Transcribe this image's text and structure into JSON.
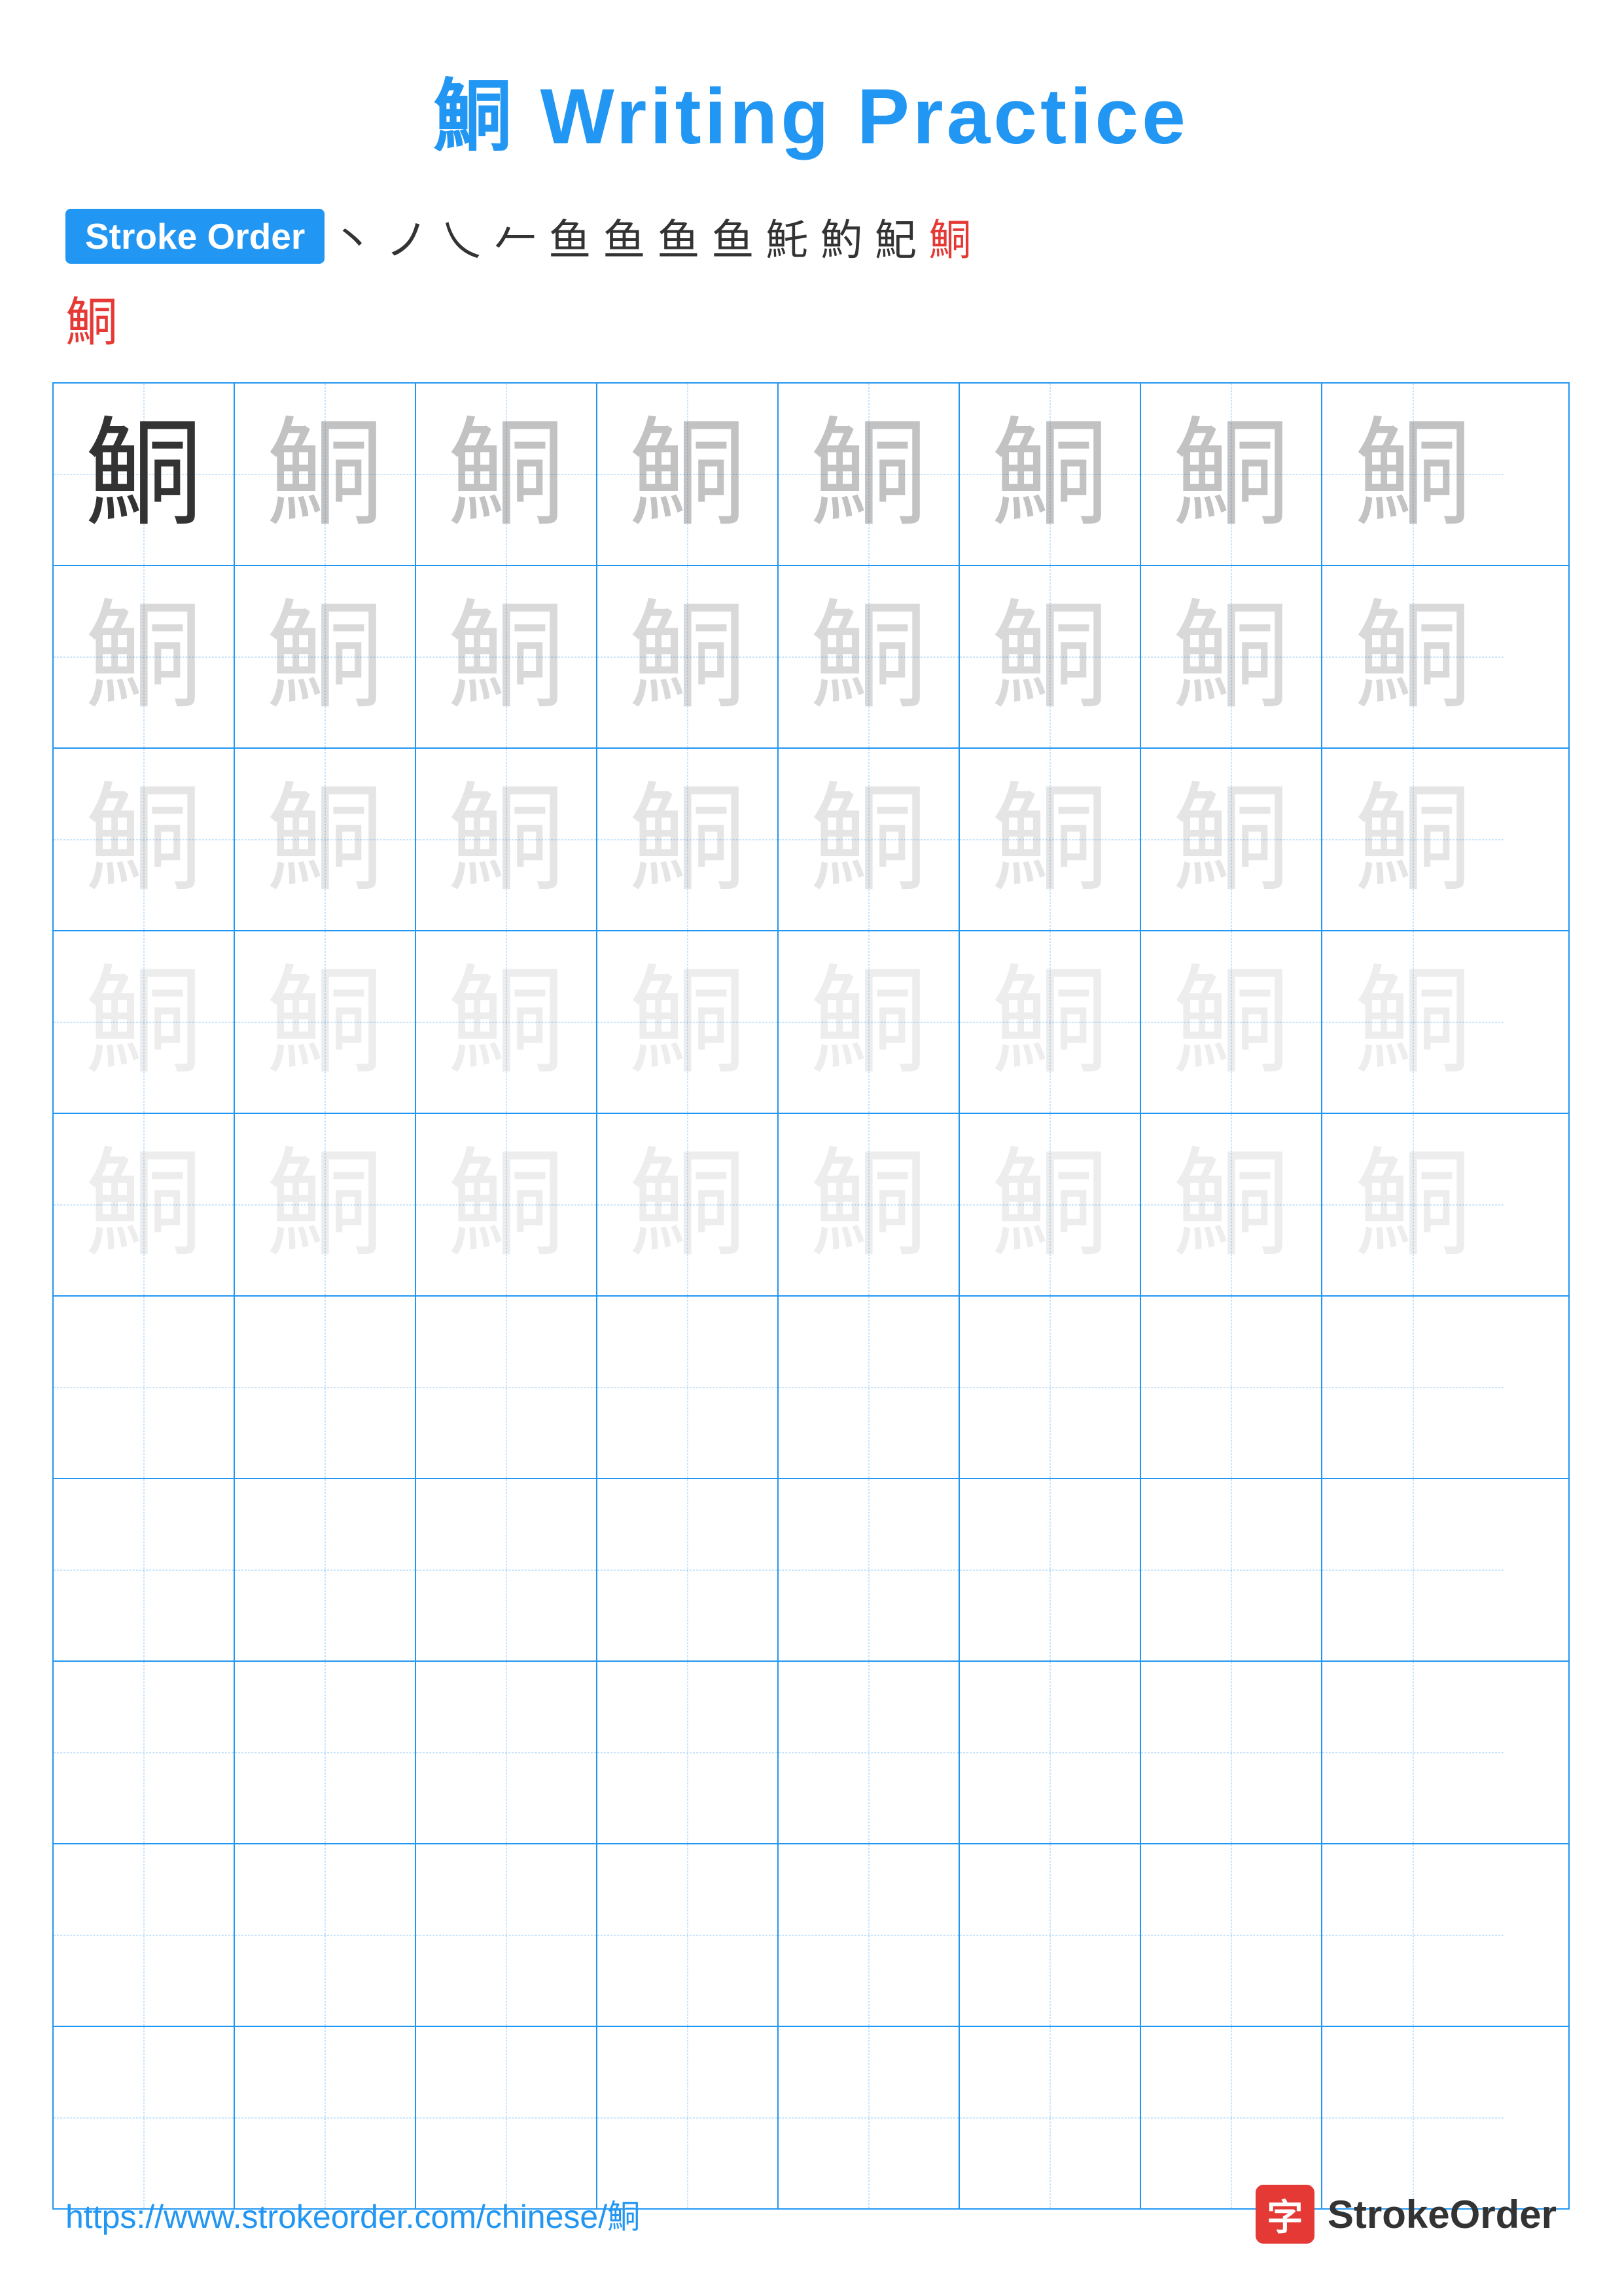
{
  "title": "鮦 Writing Practice",
  "stroke_order": {
    "badge_label": "Stroke Order",
    "chars": [
      "丶",
      "ノ",
      "乀",
      "𠂉",
      "𠂊",
      "𠂋",
      "𠂌",
      "魚",
      "魞",
      "魠",
      "魡",
      "鮦"
    ],
    "final_char": "鮦"
  },
  "character": "鮦",
  "grid": {
    "rows": 10,
    "cols": 8,
    "filled_rows": 5,
    "empty_rows": 5
  },
  "footer": {
    "url": "https://www.strokeorder.com/chinese/鮦",
    "logo_icon": "字",
    "logo_text": "StrokeOrder"
  }
}
